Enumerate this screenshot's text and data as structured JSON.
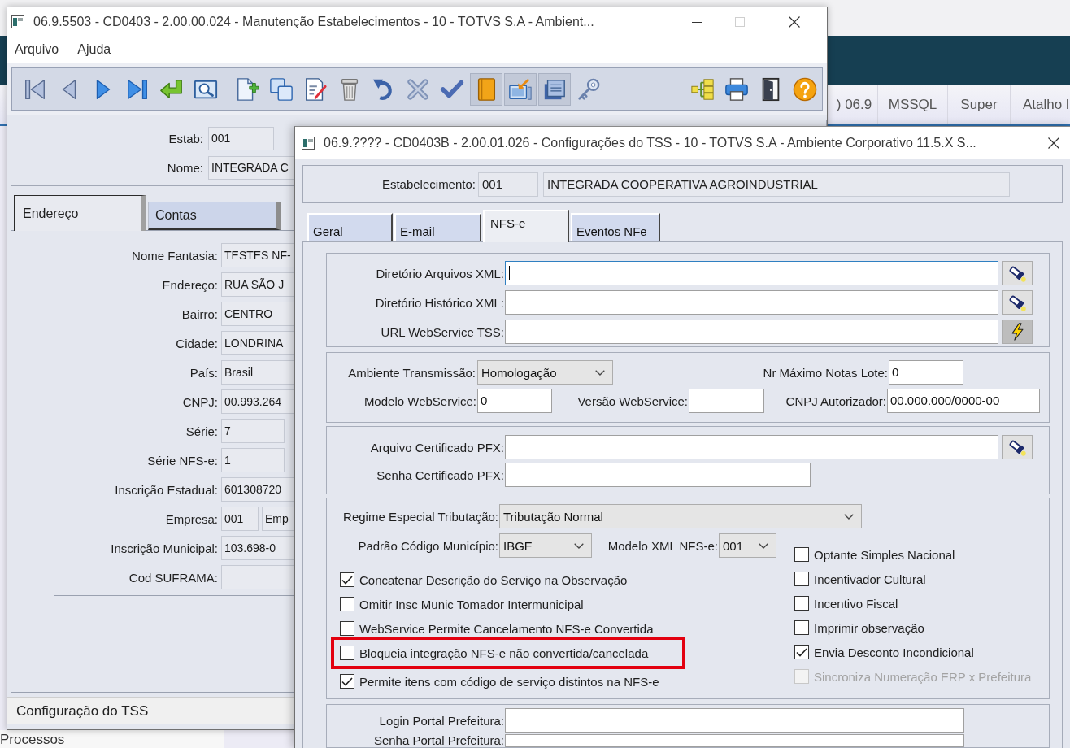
{
  "background": {
    "nav_items": [
      ") 06.9",
      "MSSQL",
      "Super",
      "Atalho l"
    ],
    "footer_text": "Processos"
  },
  "main_window": {
    "title": "06.9.5503 - CD0403 - 2.00.00.024 - Manutenção Estabelecimentos - 10 - TOTVS S.A - Ambient...",
    "maximize": {
      "disabled": true
    },
    "menu": [
      "Arquivo",
      "Ajuda"
    ],
    "toolbar": [
      {
        "pressed": false
      },
      {
        "pressed": false
      },
      {
        "pressed": false
      },
      {
        "pressed": false
      },
      {
        "pressed": false
      },
      {
        "pressed": false
      },
      {
        "pressed": false
      },
      {
        "pressed": false
      },
      {
        "pressed": false
      },
      {
        "pressed": false
      },
      {
        "pressed": false
      },
      {
        "pressed": false
      },
      {
        "pressed": false
      },
      {
        "pressed": true
      },
      {
        "pressed": true
      },
      {
        "pressed": true
      },
      {
        "pressed": false
      },
      {
        "pressed": false
      },
      {
        "pressed": false
      },
      {
        "pressed": false
      },
      {
        "pressed": false
      }
    ],
    "header": [
      {
        "label": "Estab:",
        "value": "001"
      },
      {
        "label": "Nome:",
        "value": "INTEGRADA C"
      }
    ],
    "tabs": [
      {
        "label": "Endereço",
        "selected": true
      },
      {
        "label": "Contas",
        "selected": false
      }
    ],
    "form": [
      {
        "label": "Nome Fantasia:",
        "value": "TESTES NF-"
      },
      {
        "label": "Endereço:",
        "value": "RUA SÃO J"
      },
      {
        "label": "Bairro:",
        "value": "CENTRO"
      },
      {
        "label": "Cidade:",
        "value": "LONDRINA"
      },
      {
        "label": "País:",
        "value": "Brasil"
      },
      {
        "label": "CNPJ:",
        "value": "00.993.264"
      },
      {
        "label": "Série:",
        "value": "7"
      },
      {
        "label": "Série NFS-e:",
        "value": "1"
      },
      {
        "label": "Inscrição Estadual:",
        "value": "601308720"
      },
      {
        "label": "Empresa:",
        "value": "001",
        "value_2": "Emp"
      },
      {
        "label": "Inscrição Municipal:",
        "value": "103.698-0"
      },
      {
        "label": "Cod SUFRAMA:"
      }
    ],
    "status_bar": "Configuração do TSS"
  },
  "dialog": {
    "title": "06.9.???? - CD0403B - 2.00.01.026 - Configurações do TSS - 10 - TOTVS S.A - Ambiente Corporativo 11.5.X S...",
    "establishment": {
      "label": "Estabelecimento:",
      "code": "001",
      "name": "INTEGRADA COOPERATIVA AGROINDUSTRIAL"
    },
    "tabs": [
      {
        "label": "Geral",
        "selected": false
      },
      {
        "label": "E-mail",
        "selected": false
      },
      {
        "label": "NFS-e",
        "selected": true
      },
      {
        "label": "Eventos NFe",
        "selected": false
      }
    ],
    "paths": [
      {
        "label": "Diretório Arquivos XML:",
        "focused": true
      },
      {
        "label": "Diretório Histórico XML:",
        "focused": false
      },
      {
        "label": "URL WebService TSS:",
        "focused": false
      }
    ],
    "transmission": {
      "environment": {
        "label": "Ambiente Transmissão:",
        "value": "Homologação"
      },
      "max_notes": {
        "label": "Nr Máximo Notas Lote:",
        "value": "0"
      },
      "ws_model": {
        "label": "Modelo WebService:",
        "value": "0"
      },
      "ws_version": {
        "label": "Versão WebService:"
      },
      "authorizer_cnpj": {
        "label": "CNPJ Autorizador:",
        "value": "00.000.000/0000-00"
      }
    },
    "certificate": {
      "file": {
        "label": "Arquivo Certificado PFX:"
      },
      "password": {
        "label": "Senha Certificado PFX:"
      }
    },
    "taxation": {
      "regime": {
        "label": "Regime Especial Tributação:",
        "value": "Tributação Normal"
      },
      "municipal_code": {
        "label": "Padrão Código Município:",
        "value": "IBGE"
      },
      "xml_model": {
        "label": "Modelo XML NFS-e:",
        "value": "001"
      },
      "options_left": [
        {
          "label": "Concatenar Descrição do Serviço na Observação",
          "checked": true,
          "disabled": false,
          "highlighted": false
        },
        {
          "label": "Omitir Insc Munic Tomador Intermunicipal",
          "checked": false,
          "disabled": false,
          "highlighted": false
        },
        {
          "label": "WebService Permite Cancelamento NFS-e Convertida",
          "checked": false,
          "disabled": false,
          "highlighted": false
        },
        {
          "label": "Bloqueia integração NFS-e não convertida/cancelada",
          "checked": false,
          "disabled": false,
          "highlighted": true
        },
        {
          "label": "Permite itens com código de serviço distintos na NFS-e",
          "checked": true,
          "disabled": false,
          "highlighted": false
        }
      ],
      "options_right": [
        {
          "label": "Optante Simples Nacional",
          "checked": false,
          "disabled": false
        },
        {
          "label": "Incentivador Cultural",
          "checked": false,
          "disabled": false
        },
        {
          "label": "Incentivo Fiscal",
          "checked": false,
          "disabled": false
        },
        {
          "label": "Imprimir observação",
          "checked": false,
          "disabled": false
        },
        {
          "label": "Envia Desconto Incondicional",
          "checked": true,
          "disabled": false
        },
        {
          "label": "Sincroniza Numeração ERP x Prefeitura",
          "checked": false,
          "disabled": true
        }
      ]
    },
    "portal": [
      {
        "label": "Login Portal Prefeitura:"
      },
      {
        "label": "Senha Portal Prefeitura:"
      }
    ]
  }
}
